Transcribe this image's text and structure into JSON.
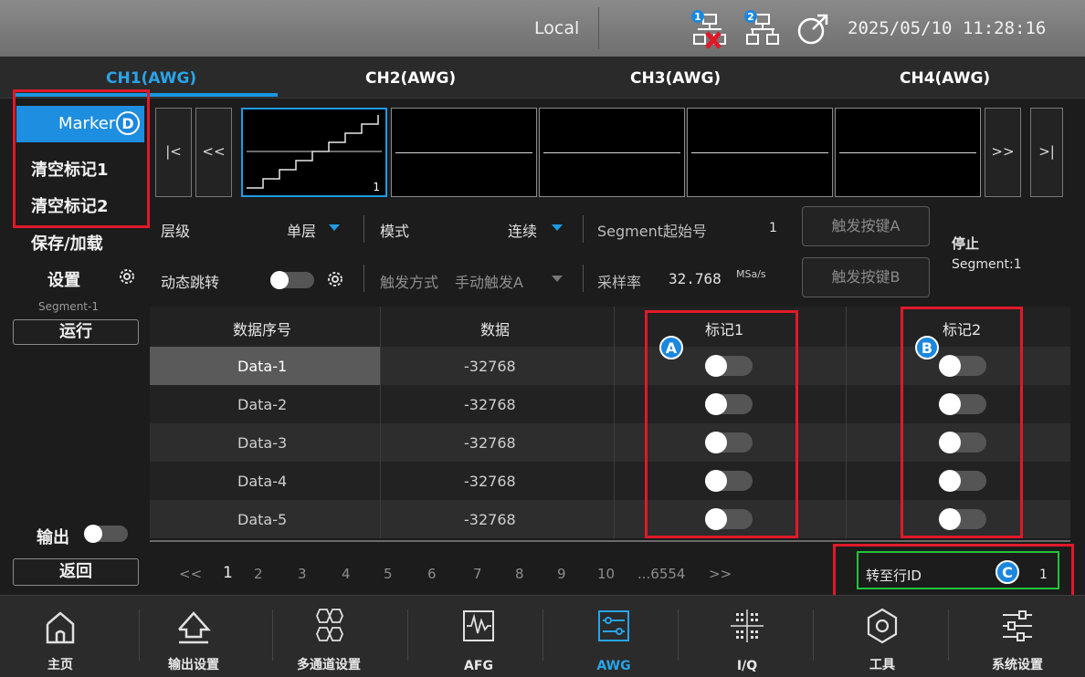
{
  "status_bar": {
    "mode": "Local",
    "datetime": "2025/05/10 11:28:16",
    "net1_badge": "1",
    "net2_badge": "2"
  },
  "channel_tabs": [
    "CH1(AWG)",
    "CH2(AWG)",
    "CH3(AWG)",
    "CH4(AWG)"
  ],
  "active_channel": 0,
  "left_menu": {
    "marker": "Marker",
    "clear1": "清空标记1",
    "clear2": "清空标记2",
    "save_load": "保存/加载",
    "settings": "设置",
    "segment": "Segment-1",
    "run": "运行",
    "output": "输出",
    "back": "返回"
  },
  "thumbnails": {
    "first": "|<",
    "prev": "<<",
    "next": ">>",
    "last": ">|",
    "active_index": "1"
  },
  "params": {
    "level_label": "层级",
    "level_value": "单层",
    "mode_label": "模式",
    "mode_value": "连续",
    "segment_start_label": "Segment起始号",
    "segment_start_value": "1",
    "trigger_a": "触发按键A",
    "trigger_b": "触发按键B",
    "state": "停止",
    "segment_state": "Segment:1",
    "dynamic_jump": "动态跳转",
    "trigger_mode_label": "触发方式",
    "trigger_mode_value": "手动触发A",
    "sample_rate_label": "采样率",
    "sample_rate_value": "32.768",
    "sample_rate_unit": "MSa/s"
  },
  "table": {
    "headers": [
      "数据序号",
      "数据",
      "标记1",
      "标记2"
    ],
    "rows": [
      {
        "id": "Data-1",
        "value": "-32768"
      },
      {
        "id": "Data-2",
        "value": "-32768"
      },
      {
        "id": "Data-3",
        "value": "-32768"
      },
      {
        "id": "Data-4",
        "value": "-32768"
      },
      {
        "id": "Data-5",
        "value": "-32768"
      }
    ]
  },
  "pager": {
    "prev": "<<",
    "pages": [
      "1",
      "2",
      "3",
      "4",
      "5",
      "6",
      "7",
      "8",
      "9",
      "10",
      "...6554"
    ],
    "next": ">>",
    "goto_label": "转至行ID",
    "goto_value": "1"
  },
  "callouts": {
    "a": "A",
    "b": "B",
    "c": "C",
    "d": "D"
  },
  "bottom_nav": [
    "主页",
    "输出设置",
    "多通道设置",
    "AFG",
    "AWG",
    "I/Q",
    "工具",
    "系统设置"
  ],
  "colors": {
    "accent": "#1e8ee0",
    "callout_red": "#e0192a",
    "callout_green": "#1fc43a"
  }
}
